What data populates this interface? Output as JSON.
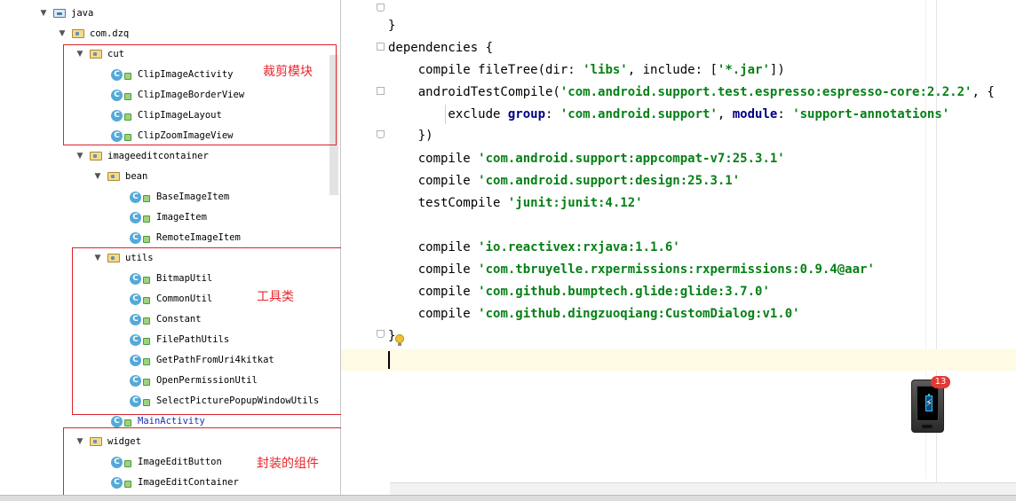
{
  "project_tree": {
    "rows": [
      {
        "label": "java",
        "type": "folder-blue",
        "expanded": true
      },
      {
        "label": "com.dzq",
        "type": "package",
        "expanded": true
      },
      {
        "label": "cut",
        "type": "package",
        "expanded": true
      },
      {
        "label": "ClipImageActivity",
        "type": "class"
      },
      {
        "label": "ClipImageBorderView",
        "type": "class"
      },
      {
        "label": "ClipImageLayout",
        "type": "class"
      },
      {
        "label": "ClipZoomImageView",
        "type": "class"
      },
      {
        "label": "imageeditcontainer",
        "type": "package",
        "expanded": true
      },
      {
        "label": "bean",
        "type": "package",
        "expanded": true
      },
      {
        "label": "BaseImageItem",
        "type": "class"
      },
      {
        "label": "ImageItem",
        "type": "class"
      },
      {
        "label": "RemoteImageItem",
        "type": "class"
      },
      {
        "label": "utils",
        "type": "package",
        "expanded": true
      },
      {
        "label": "BitmapUtil",
        "type": "class"
      },
      {
        "label": "CommonUtil",
        "type": "class"
      },
      {
        "label": "Constant",
        "type": "class"
      },
      {
        "label": "FilePathUtils",
        "type": "class"
      },
      {
        "label": "GetPathFromUri4kitkat",
        "type": "class"
      },
      {
        "label": "OpenPermissionUtil",
        "type": "class"
      },
      {
        "label": "SelectPicturePopupWindowUtils",
        "type": "class"
      },
      {
        "label": "MainActivity",
        "type": "class"
      },
      {
        "label": "widget",
        "type": "package",
        "expanded": true
      },
      {
        "label": "ImageEditButton",
        "type": "class"
      },
      {
        "label": "ImageEditContainer",
        "type": "class"
      }
    ]
  },
  "annotations": {
    "cut": "裁剪模块",
    "utils": "工具类",
    "widget": "封装的组件"
  },
  "editor": {
    "lines": {
      "l0": "}",
      "l1": "dependencies {",
      "l2_a": "    compile fileTree(dir: ",
      "l2_b": "'libs'",
      "l2_c": ", include: [",
      "l2_d": "'*.jar'",
      "l2_e": "])",
      "l3_a": "    androidTestCompile(",
      "l3_b": "'com.android.support.test.espresso:espresso-core:2.2.2'",
      "l3_c": ", {",
      "l4_a": "        exclude ",
      "l4_b": "group",
      "l4_c": ": ",
      "l4_d": "'com.android.support'",
      "l4_e": ", ",
      "l4_f": "module",
      "l4_g": ": ",
      "l4_h": "'support-annotations'",
      "l5": "    })",
      "l6_a": "    compile ",
      "l6_b": "'com.android.support:appcompat-v7:25.3.1'",
      "l7_a": "    compile ",
      "l7_b": "'com.android.support:design:25.3.1'",
      "l8_a": "    testCompile ",
      "l8_b": "'junit:junit:4.12'",
      "l9_a": "    compile ",
      "l9_b": "'io.reactivex:rxjava:1.1.6'",
      "l10_a": "    compile ",
      "l10_b": "'com.tbruyelle.rxpermissions:rxpermissions:0.9.4@aar'",
      "l11_a": "    compile ",
      "l11_b": "'com.github.bumptech.glide:glide:3.7.0'",
      "l12_a": "    compile ",
      "l12_b": "'com.github.dingzuoqiang:CustomDialog:v1.0'",
      "l13": "}"
    }
  },
  "phone_widget": {
    "badge_count": "13"
  },
  "colors": {
    "annotation_red": "#d9252a",
    "string_green": "#068016",
    "keyword_navy": "#000080",
    "class_icon_blue": "#54a9d8",
    "caret_line_bg": "#fffae3"
  }
}
